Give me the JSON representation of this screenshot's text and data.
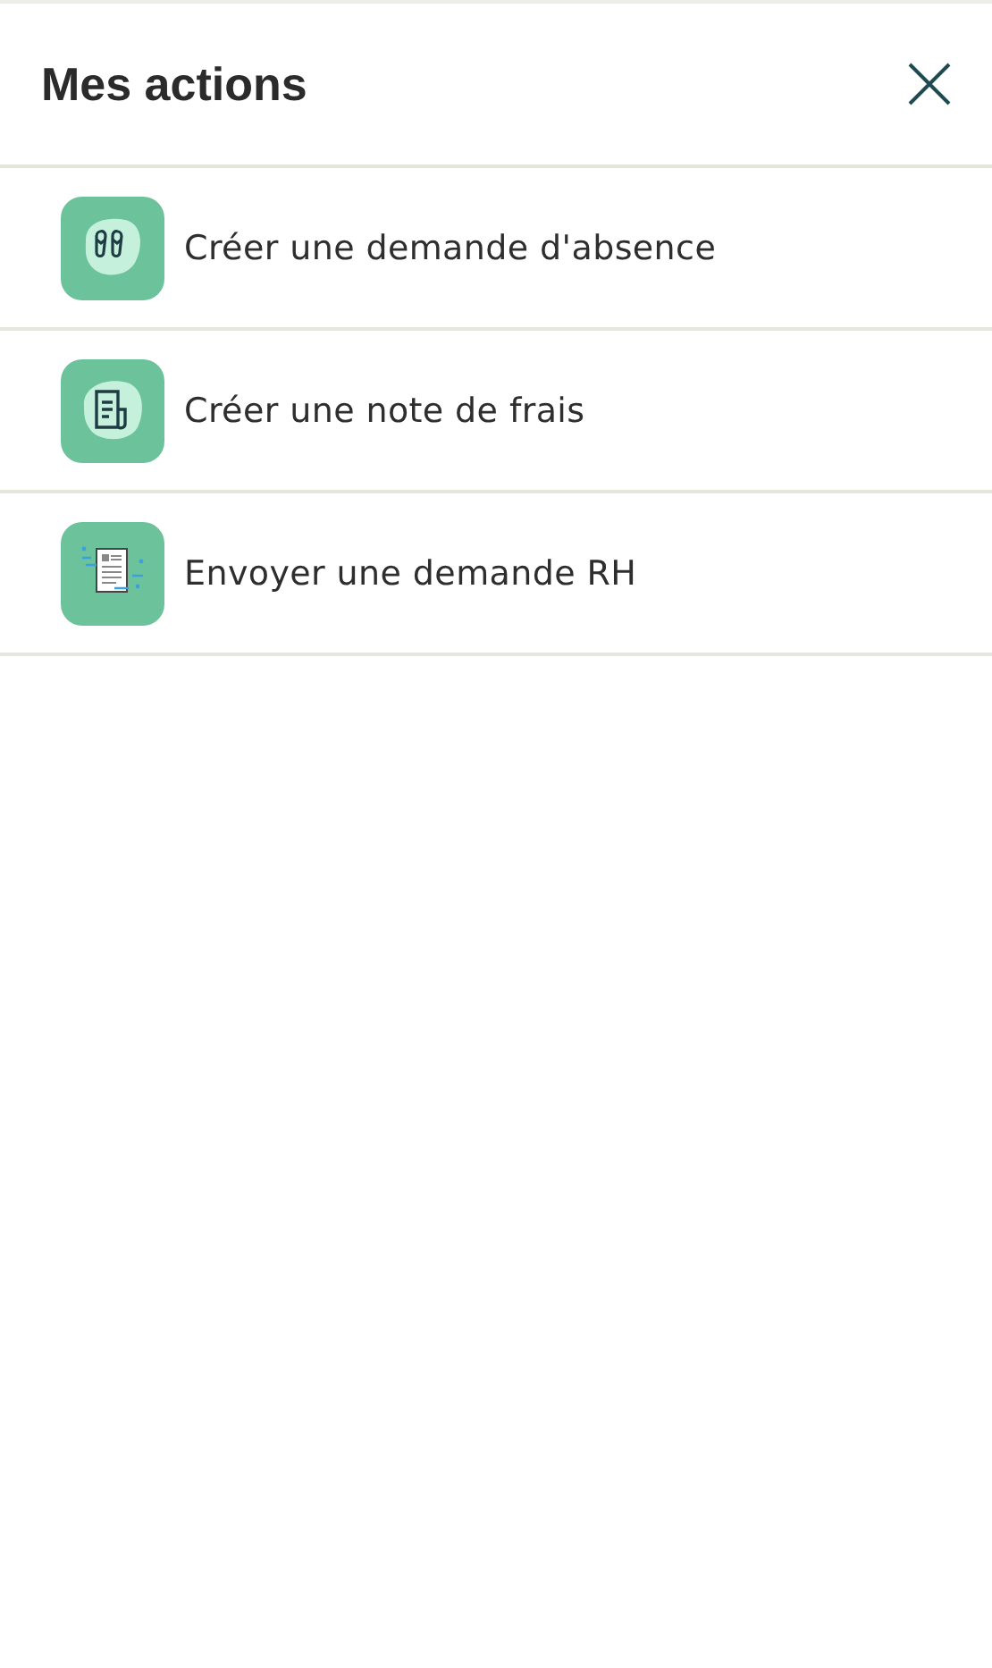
{
  "header": {
    "title": "Mes actions"
  },
  "actions": [
    {
      "kind": "sandals",
      "label": "Créer une demande d'absence"
    },
    {
      "kind": "receipt",
      "label": "Créer une note de frais"
    },
    {
      "kind": "document",
      "label": "Envoyer une demande RH"
    }
  ]
}
